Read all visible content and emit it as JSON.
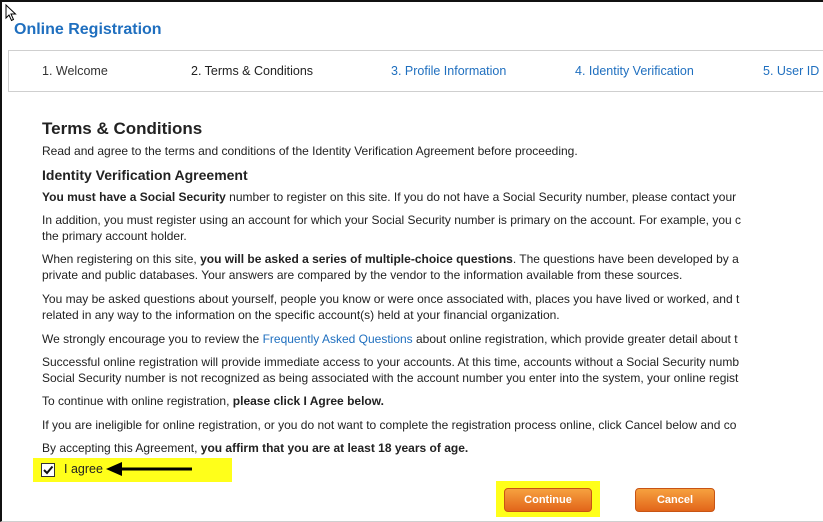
{
  "app": {
    "title": "Online Registration"
  },
  "steps": [
    {
      "label": "1. Welcome",
      "state": "done"
    },
    {
      "label": "2. Terms & Conditions",
      "state": "current"
    },
    {
      "label": "3. Profile Information",
      "state": "upcoming"
    },
    {
      "label": "4. Identity Verification",
      "state": "upcoming"
    },
    {
      "label": "5. User ID",
      "state": "upcoming"
    }
  ],
  "terms": {
    "heading": "Terms & Conditions",
    "intro": "Read and agree to the terms and conditions of the Identity Verification Agreement before proceeding.",
    "subheading": "Identity Verification Agreement",
    "p1_bold": "You must have a Social Security",
    "p1_rest": " number to register on this site. If you do not have a Social Security number, please contact your",
    "p2_line1": "In addition, you must register using an account for which your Social Security number is primary on the account. For example, you c",
    "p2_line2": "the primary account holder.",
    "p3_pre": "When registering on this site, ",
    "p3_bold": "you will be asked a series of multiple-choice questions",
    "p3_post": ". The questions have been developed by a",
    "p3_line2": "private and public databases. Your answers are compared by the vendor to the information available from these sources.",
    "p4_line1": "You may be asked questions about yourself, people you know or were once associated with, places you have lived or worked, and t",
    "p4_line2": "related in any way to the information on the specific account(s) held at your financial organization.",
    "p5_pre": "We strongly encourage you to review the ",
    "p5_link": "Frequently Asked Questions",
    "p5_post": " about online registration, which provide greater detail about t",
    "p6_line1": "Successful online registration will provide immediate access to your accounts. At this time, accounts without a Social Security numb",
    "p6_line2": "Social Security number is not recognized as being associated with the account number you enter into the system, your online regist",
    "p7_pre": "To continue with online registration, ",
    "p7_bold": "please click I Agree below.",
    "p8": "If you are ineligible for online registration, or you do not want to complete the registration process online, click Cancel below and co",
    "p9_pre": "By accepting this Agreement, ",
    "p9_bold": "you affirm that you are at least 18 years of age."
  },
  "agree": {
    "label": "I agree",
    "checked": true
  },
  "buttons": {
    "continue": "Continue",
    "cancel": "Cancel"
  },
  "colors": {
    "link": "#1f6fbf",
    "highlight": "#ffff1a",
    "button_orange": "#e8751f"
  }
}
